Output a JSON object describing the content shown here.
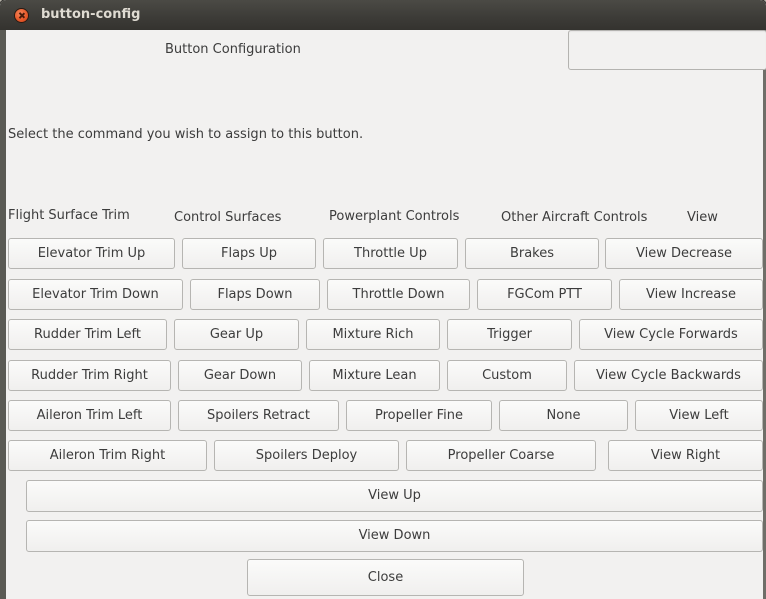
{
  "window": {
    "title": "button-config"
  },
  "header": {
    "title": "Button Configuration",
    "instruction": "Select the command you wish to assign to this button.",
    "entry_value": ""
  },
  "columns": [
    "Flight Surface Trim",
    "Control Surfaces",
    "Powerplant Controls",
    "Other Aircraft Controls",
    "View"
  ],
  "rows": [
    [
      "Elevator Trim Up",
      "Flaps Up",
      "Throttle Up",
      "Brakes",
      "View Decrease"
    ],
    [
      "Elevator Trim Down",
      "Flaps Down",
      "Throttle Down",
      "FGCom PTT",
      "View Increase"
    ],
    [
      "Rudder Trim Left",
      "Gear Up",
      "Mixture Rich",
      "Trigger",
      "View Cycle Forwards"
    ],
    [
      "Rudder Trim Right",
      "Gear Down",
      "Mixture Lean",
      "Custom",
      "View Cycle Backwards"
    ],
    [
      "Aileron Trim Left",
      "Spoilers Retract",
      "Propeller Fine",
      "None",
      "View Left"
    ],
    [
      "Aileron Trim Right",
      "Spoilers Deploy",
      "Propeller Coarse",
      "View Right"
    ]
  ],
  "wide_buttons": [
    "View Up",
    "View Down"
  ],
  "close_label": "Close"
}
